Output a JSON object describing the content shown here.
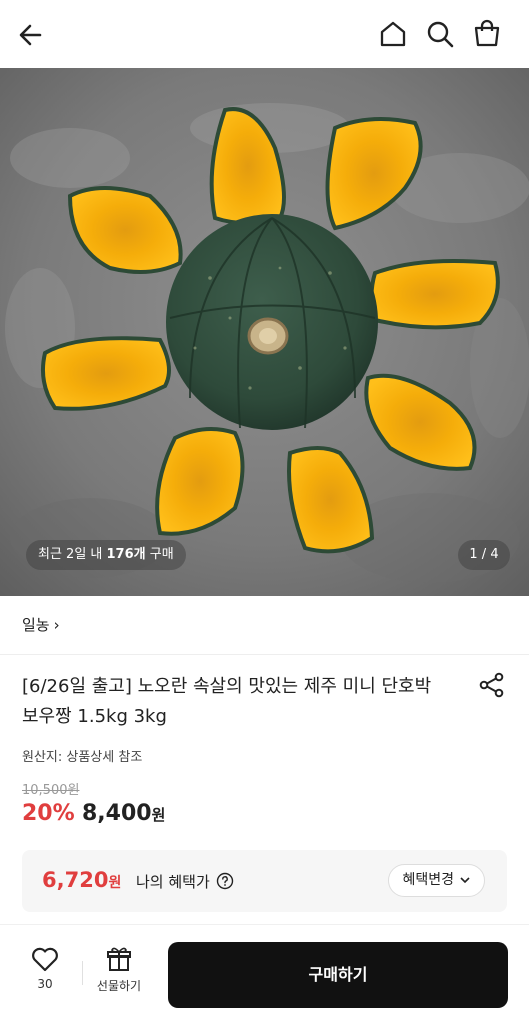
{
  "header": {
    "back_icon": "arrow-left-icon",
    "home_icon": "home-icon",
    "search_icon": "search-icon",
    "bag_icon": "shopping-bag-icon"
  },
  "hero": {
    "recent_prefix": "최근 2일 내 ",
    "recent_count": "176개",
    "recent_suffix": " 구매",
    "pager": "1 / 4"
  },
  "seller": {
    "name": "일농",
    "chevron": "›"
  },
  "product": {
    "title": "[6/26일 출고] 노오란 속살의 맛있는 제주 미니 단호박 보우짱 1.5kg 3kg",
    "origin": "원산지: 상품상세 참조",
    "original_price": "10,500원",
    "discount": "20%",
    "price": "8,400",
    "price_unit": "원"
  },
  "benefit": {
    "price": "6,720",
    "price_unit": "원",
    "label": "나의 혜택가",
    "change_label": "혜택변경"
  },
  "bottom": {
    "like_count": "30",
    "gift_label": "선물하기",
    "buy_label": "구매하기"
  },
  "colors": {
    "accent_red": "#e03e3e",
    "buy_button": "#111111",
    "pumpkin_flesh": "#f5a800",
    "pumpkin_skin": "#2e4a3a"
  }
}
